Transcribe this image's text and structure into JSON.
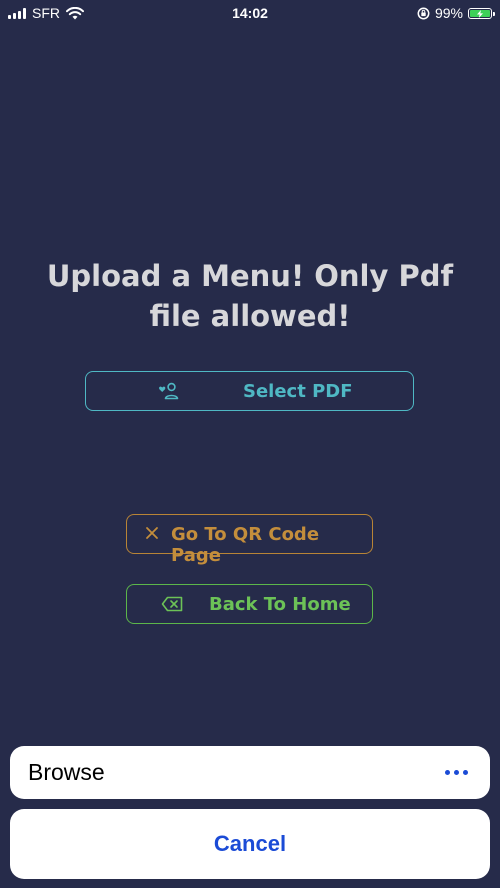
{
  "status_bar": {
    "carrier": "SFR",
    "time": "14:02",
    "battery_percent": "99%",
    "battery_level": 0.99,
    "battery_color": "#3ed158"
  },
  "main": {
    "title_line1": "Upload a Menu! Only Pdf",
    "title_line2": "file allowed!",
    "select_pdf_label": "Select PDF",
    "qr_button_label": "Go To QR Code Page",
    "home_button_label": "Back To Home",
    "icons": {
      "select_pdf": "person-heart-icon",
      "qr": "close-icon",
      "home": "backspace-icon"
    }
  },
  "action_sheet": {
    "browse_label": "Browse",
    "more_icon": "more-dots-icon",
    "cancel_label": "Cancel"
  },
  "colors": {
    "background": "#262b4a",
    "select_accent": "#4fb8c4",
    "qr_accent": "#c48e3c",
    "home_accent": "#6cc257",
    "sheet_accent": "#1b4bd6"
  }
}
